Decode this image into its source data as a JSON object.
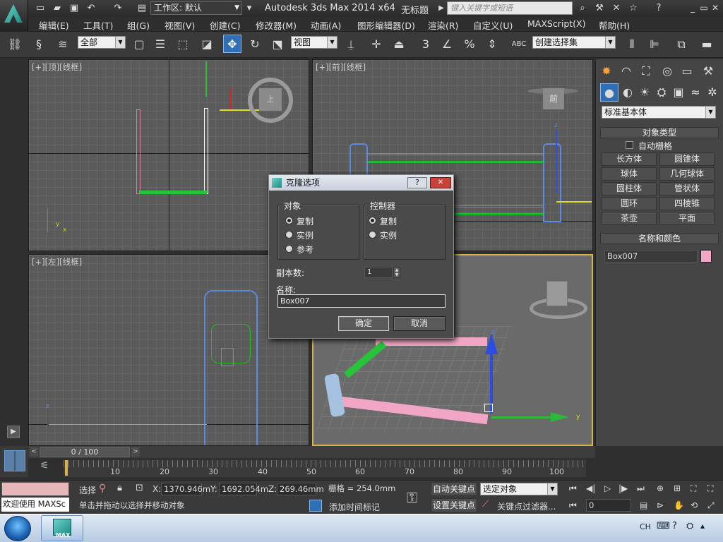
{
  "title_bar": {
    "workspace": "工作区: 默认",
    "app_title": "Autodesk 3ds Max  2014 x64",
    "doc_title": "无标题",
    "search_placeholder": "键入关键字或短语"
  },
  "menu": [
    "编辑(E)",
    "工具(T)",
    "组(G)",
    "视图(V)",
    "创建(C)",
    "修改器(M)",
    "动画(A)",
    "图形编辑器(D)",
    "渲染(R)",
    "自定义(U)",
    "MAXScript(X)",
    "帮助(H)"
  ],
  "toolbar": {
    "selection_filter": "全部",
    "ref_coord": "视图",
    "named_selection": "创建选择集",
    "snap_label": "3",
    "abc": "ABC"
  },
  "viewports": {
    "top": "[+][顶][线框]",
    "front": "[+][前][线框]",
    "left": "[+][左][线框]",
    "cube_top": "上",
    "cube_front": "前",
    "axis_x": "x",
    "axis_y": "y",
    "axis_z": "z"
  },
  "command_panel": {
    "category": "标准基本体",
    "object_type_title": "对象类型",
    "autogrid": "自动栅格",
    "buttons": [
      "长方体",
      "圆锥体",
      "球体",
      "几何球体",
      "圆柱体",
      "管状体",
      "圆环",
      "四棱锥",
      "茶壶",
      "平面"
    ],
    "name_color_title": "名称和颜色",
    "object_name": "Box007",
    "object_color": "#f4a6c8"
  },
  "dialog": {
    "title": "克隆选项",
    "object_group": "对象",
    "object_options": [
      "复制",
      "实例",
      "参考"
    ],
    "object_selected": 0,
    "controller_group": "控制器",
    "controller_options": [
      "复制",
      "实例"
    ],
    "controller_selected": 0,
    "copies_label": "副本数:",
    "copies_value": "1",
    "name_label": "名称:",
    "name_value": "Box007",
    "ok": "确定",
    "cancel": "取消",
    "help": "?",
    "close": "✕"
  },
  "timeline": {
    "frame": "0 / 100",
    "ticks": [
      "10",
      "20",
      "30",
      "40",
      "50",
      "60",
      "70",
      "80",
      "90",
      "100"
    ]
  },
  "status": {
    "welcome": "欢迎使用 MAXSc",
    "select_label": "选择",
    "x_label": "X:",
    "x": "1370.946m",
    "y_label": "Y:",
    "y": "1692.054m",
    "z_label": "Z:",
    "z": "269.46mm",
    "grid": "栅格 = 254.0mm",
    "prompt": "单击并拖动以选择并移动对象",
    "add_time_tag": "添加时间标记",
    "auto_key": "自动关键点",
    "set_key": "设置关键点",
    "key_mode": "选定对象",
    "key_filters": "关键点过滤器...",
    "frame_field": "0"
  },
  "taskbar": {
    "app_label": "MAX",
    "lang": "CH"
  }
}
